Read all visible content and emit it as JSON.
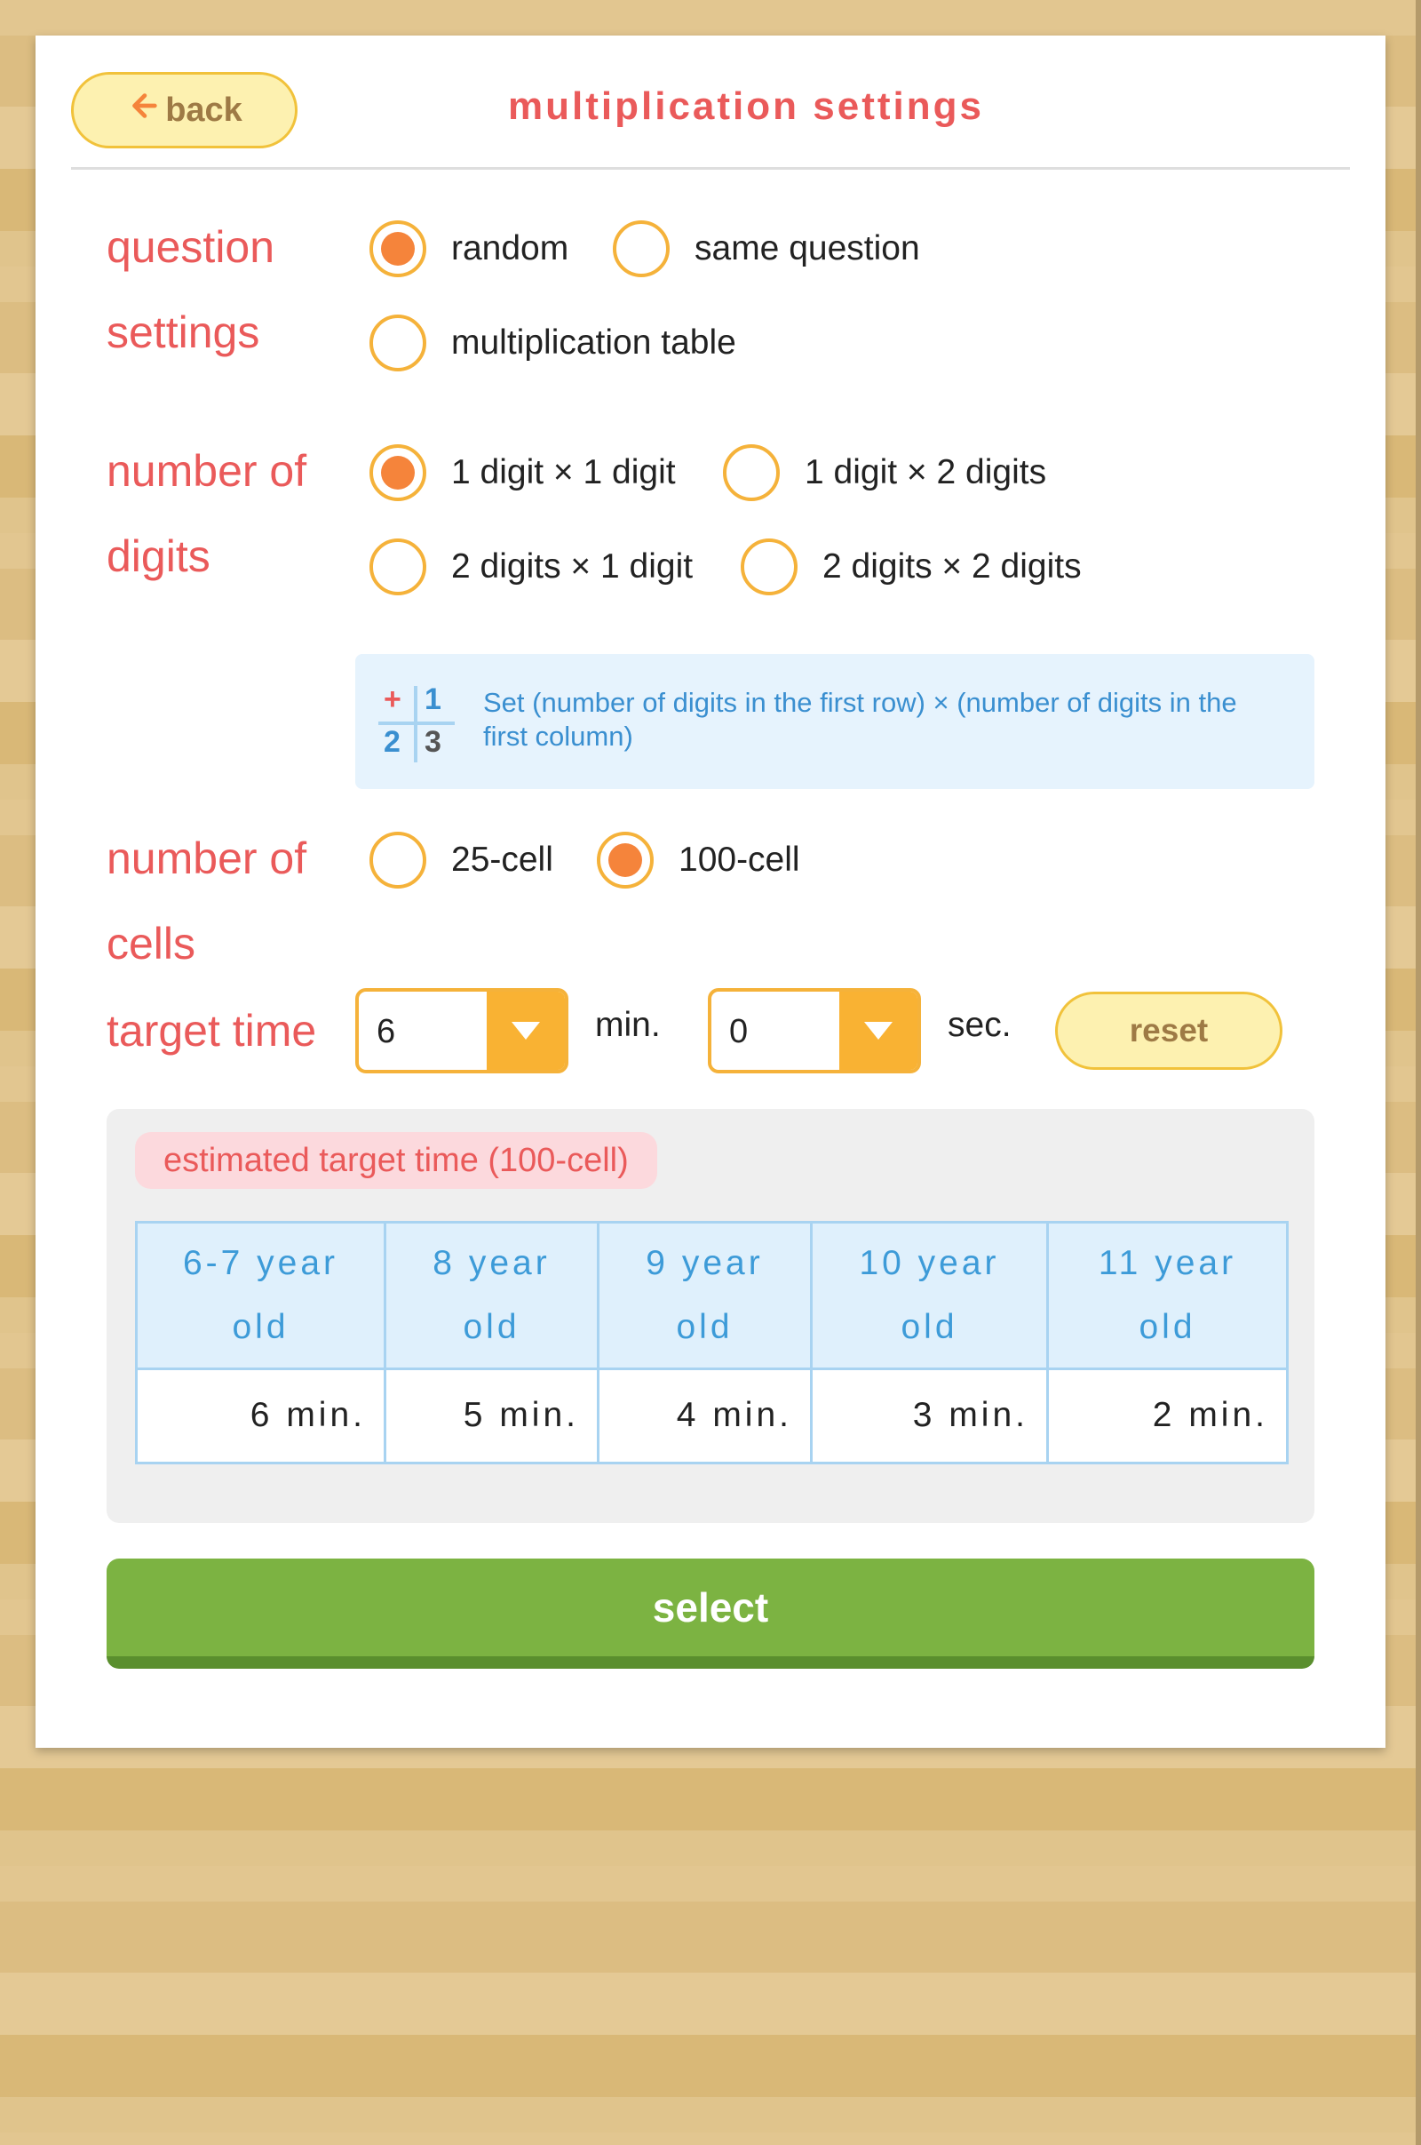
{
  "header": {
    "back_label": "back",
    "title": "multiplication settings"
  },
  "question_settings": {
    "label_line1": "question",
    "label_line2": "settings",
    "options": [
      {
        "label": "random",
        "selected": true
      },
      {
        "label": "same question",
        "selected": false
      },
      {
        "label": "multiplication table",
        "selected": false
      }
    ]
  },
  "digits": {
    "label_line1": "number of",
    "label_line2": "digits",
    "options": [
      {
        "label": "1 digit × 1 digit",
        "selected": true
      },
      {
        "label": "1 digit × 2 digits",
        "selected": false
      },
      {
        "label": "2 digits × 1 digit",
        "selected": false
      },
      {
        "label": "2 digits × 2 digits",
        "selected": false
      }
    ],
    "info": {
      "icon": {
        "op": "+",
        "a": "1",
        "b": "2",
        "c": "3"
      },
      "text": "Set (number of digits in the first row) × (number of digits in the first column)"
    }
  },
  "cells": {
    "label_line1": "number of",
    "label_line2": "cells",
    "options": [
      {
        "label": "25-cell",
        "selected": false
      },
      {
        "label": "100-cell",
        "selected": true
      }
    ]
  },
  "target_time": {
    "label": "target time",
    "minutes_value": "6",
    "minutes_unit": "min.",
    "seconds_value": "0",
    "seconds_unit": "sec.",
    "reset_label": "reset"
  },
  "estimate": {
    "title": "estimated target time (100-cell)",
    "headers": [
      [
        "6-7 year",
        "old"
      ],
      [
        "8 year",
        "old"
      ],
      [
        "9 year",
        "old"
      ],
      [
        "10 year",
        "old"
      ],
      [
        "11 year",
        "old"
      ]
    ],
    "values": [
      "6 min.",
      "5 min.",
      "4 min.",
      "3 min.",
      "2 min."
    ]
  },
  "select_label": "select",
  "colors": {
    "accent_red": "#ea5a5a",
    "radio_orange": "#f5843b",
    "radio_ring": "#f5b23a",
    "select_green": "#7cb342",
    "info_blue": "#3a8fd0"
  }
}
